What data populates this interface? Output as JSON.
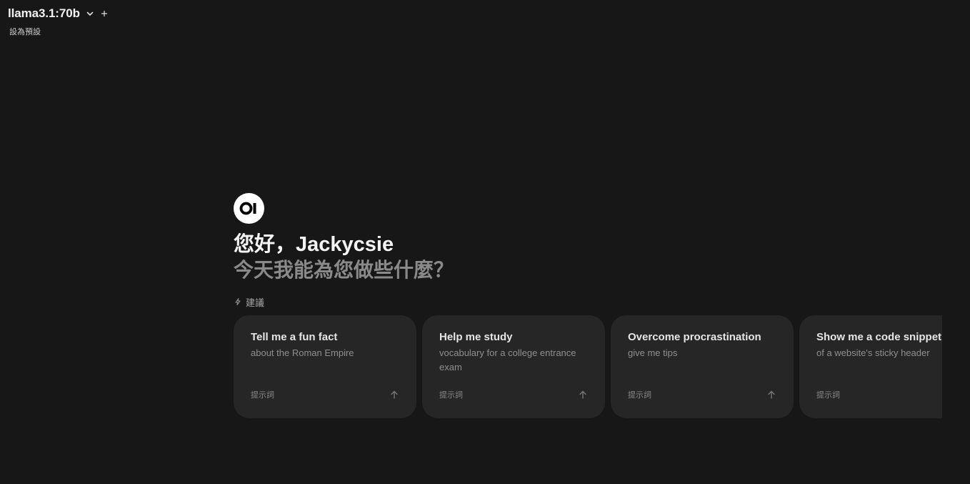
{
  "header": {
    "model_name": "llama3.1:70b",
    "set_default_label": "設為預設"
  },
  "hero": {
    "logo_text": "OI",
    "greeting": "您好，Jackycsie",
    "subgreeting": "今天我能為您做些什麼？",
    "suggestions_label": "建議"
  },
  "suggestions": [
    {
      "title": "Tell me a fun fact",
      "subtitle": "about the Roman Empire",
      "label": "提示詞"
    },
    {
      "title": "Help me study",
      "subtitle": "vocabulary for a college entrance exam",
      "label": "提示詞"
    },
    {
      "title": "Overcome procrastination",
      "subtitle": "give me tips",
      "label": "提示詞"
    },
    {
      "title": "Show me a code snippet",
      "subtitle": "of a website's sticky header",
      "label": "提示詞"
    }
  ],
  "icons": {
    "model_dropdown": "chevron-down-icon",
    "new_model": "plus-icon",
    "suggestions": "bolt-icon",
    "send_prompt": "arrow-up-icon"
  },
  "colors": {
    "background": "#171717",
    "card": "#262626",
    "muted_text": "#8a8a8a"
  }
}
